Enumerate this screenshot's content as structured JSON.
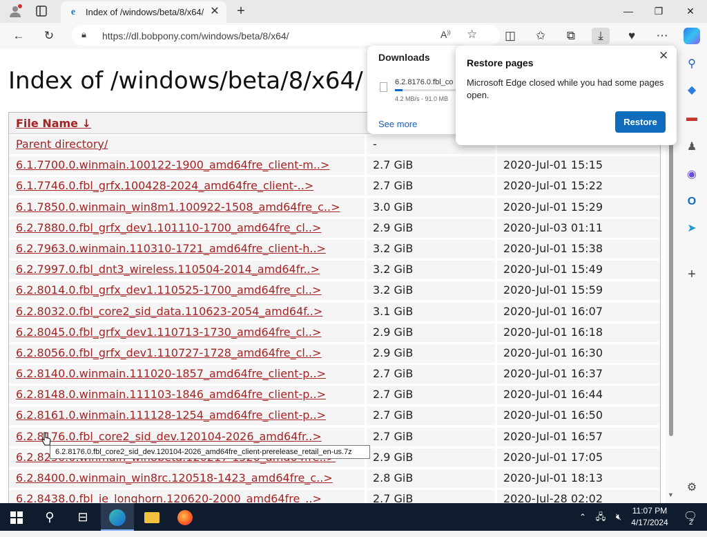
{
  "browser": {
    "tab_title": "Index of /windows/beta/8/x64/",
    "url": "https://dl.bobpony.com/windows/beta/8/x64/",
    "new_tab_glyph": "+"
  },
  "page": {
    "heading": "Index of /windows/beta/8/x64/",
    "columns": {
      "name": "File Name  ↓"
    },
    "parent": {
      "name": "Parent directory/",
      "size": "-",
      "date": "-"
    },
    "rows": [
      {
        "name": "6.1.7700.0.winmain.100122-1900_amd64fre_client-m..>",
        "size": "2.7 GiB",
        "date": "2020-Jul-01 15:15"
      },
      {
        "name": "6.1.7746.0.fbl_grfx.100428-2024_amd64fre_client-..>",
        "size": "2.7 GiB",
        "date": "2020-Jul-01 15:22"
      },
      {
        "name": "6.1.7850.0.winmain_win8m1.100922-1508_amd64fre_c..>",
        "size": "3.0 GiB",
        "date": "2020-Jul-01 15:29"
      },
      {
        "name": "6.2.7880.0.fbl_grfx_dev1.101110-1700_amd64fre_cl..>",
        "size": "2.9 GiB",
        "date": "2020-Jul-03 01:11"
      },
      {
        "name": "6.2.7963.0.winmain.110310-1721_amd64fre_client-h..>",
        "size": "3.2 GiB",
        "date": "2020-Jul-01 15:38"
      },
      {
        "name": "6.2.7997.0.fbl_dnt3_wireless.110504-2014_amd64fr..>",
        "size": "3.2 GiB",
        "date": "2020-Jul-01 15:49"
      },
      {
        "name": "6.2.8014.0.fbl_grfx_dev1.110525-1700_amd64fre_cl..>",
        "size": "3.2 GiB",
        "date": "2020-Jul-01 15:59"
      },
      {
        "name": "6.2.8032.0.fbl_core2_sid_data.110623-2054_amd64f..>",
        "size": "3.1 GiB",
        "date": "2020-Jul-01 16:07"
      },
      {
        "name": "6.2.8045.0.fbl_grfx_dev1.110713-1730_amd64fre_cl..>",
        "size": "2.9 GiB",
        "date": "2020-Jul-01 16:18"
      },
      {
        "name": "6.2.8056.0.fbl_grfx_dev1.110727-1728_amd64fre_cl..>",
        "size": "2.9 GiB",
        "date": "2020-Jul-01 16:30"
      },
      {
        "name": "6.2.8140.0.winmain.111020-1857_amd64fre_client-p..>",
        "size": "2.7 GiB",
        "date": "2020-Jul-01 16:37"
      },
      {
        "name": "6.2.8148.0.winmain.111103-1846_amd64fre_client-p..>",
        "size": "2.7 GiB",
        "date": "2020-Jul-01 16:44"
      },
      {
        "name": "6.2.8161.0.winmain.111128-1254_amd64fre_client-p..>",
        "size": "2.7 GiB",
        "date": "2020-Jul-01 16:50"
      },
      {
        "name": "6.2.8176.0.fbl_core2_sid_dev.120104-2026_amd64fr..>",
        "size": "2.7 GiB",
        "date": "2020-Jul-01 16:57"
      },
      {
        "name": "6.2.8250.0.winmain_win8beta.120217-1520_amd64fre..>",
        "size": "2.9 GiB",
        "date": "2020-Jul-01 17:05"
      },
      {
        "name": "6.2.8400.0.winmain_win8rc.120518-1423_amd64fre_c..>",
        "size": "2.8 GiB",
        "date": "2020-Jul-01 18:13"
      },
      {
        "name": "6.2.8438.0.fbl_ie_longhorn.120620-2000_amd64fre_..>",
        "size": "2.7 GiB",
        "date": "2020-Jul-28 02:02"
      }
    ]
  },
  "downloads": {
    "title": "Downloads",
    "file_name": "6.2.8176.0.fbl_co",
    "progress": 0.12,
    "status": "4.2 MB/s - 91.0 MB",
    "see_more": "See more"
  },
  "restore": {
    "title": "Restore pages",
    "message": "Microsoft Edge closed while you had some pages open.",
    "button": "Restore"
  },
  "tooltip": "6.2.8176.0.fbl_core2_sid_dev.120104-2026_amd64fre_client-prerelease_retail_en-us.7z",
  "taskbar": {
    "time": "11:07 PM",
    "date": "4/17/2024",
    "notification_count": "2"
  },
  "colors": {
    "link": "#a32424",
    "accent": "#0f6cbd",
    "taskbar": "#0f1c2e"
  }
}
